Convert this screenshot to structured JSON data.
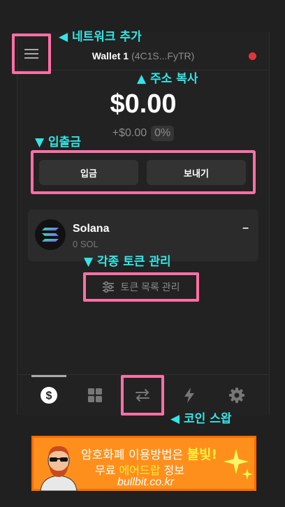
{
  "header": {
    "wallet_name": "Wallet 1",
    "wallet_address": "(4C1S...FyTR)",
    "menu_icon": "hamburger-menu-icon",
    "status_color": "#e0353c"
  },
  "balance": {
    "total": "$0.00",
    "change": "+$0.00",
    "change_pct": "0%"
  },
  "actions": {
    "deposit_label": "입금",
    "send_label": "보내기"
  },
  "tokens": [
    {
      "name": "Solana",
      "amount": "0 SOL",
      "value": "–",
      "icon": "solana-logo-icon"
    }
  ],
  "manage_tokens_label": "토큰 목록 관리",
  "bottom_nav": [
    {
      "icon": "dollar-icon",
      "active": true
    },
    {
      "icon": "grid-icon",
      "active": false
    },
    {
      "icon": "swap-arrows-icon",
      "active": false
    },
    {
      "icon": "lightning-icon",
      "active": false
    },
    {
      "icon": "gear-icon",
      "active": false
    }
  ],
  "annotations": {
    "add_network": "◀ 네트워크 추가",
    "copy_address": "▲ 주소 복사",
    "deposit_withdraw": "▼ 입출금",
    "manage_tokens": "▼ 각종 토큰 관리",
    "coin_swap": "◀ 코인 스왑"
  },
  "banner": {
    "line1_prefix": "암호화폐 이용방법은 ",
    "line1_highlight": "불빛!",
    "line2_prefix": "무료 ",
    "line2_highlight": "에어드랍",
    "line2_suffix": " 정보",
    "url": "bullbit.co.kr"
  },
  "colors": {
    "accent_pink": "#ff6fa6",
    "annotation_cyan": "#32e6e6",
    "banner_orange": "#ff8f1c"
  }
}
